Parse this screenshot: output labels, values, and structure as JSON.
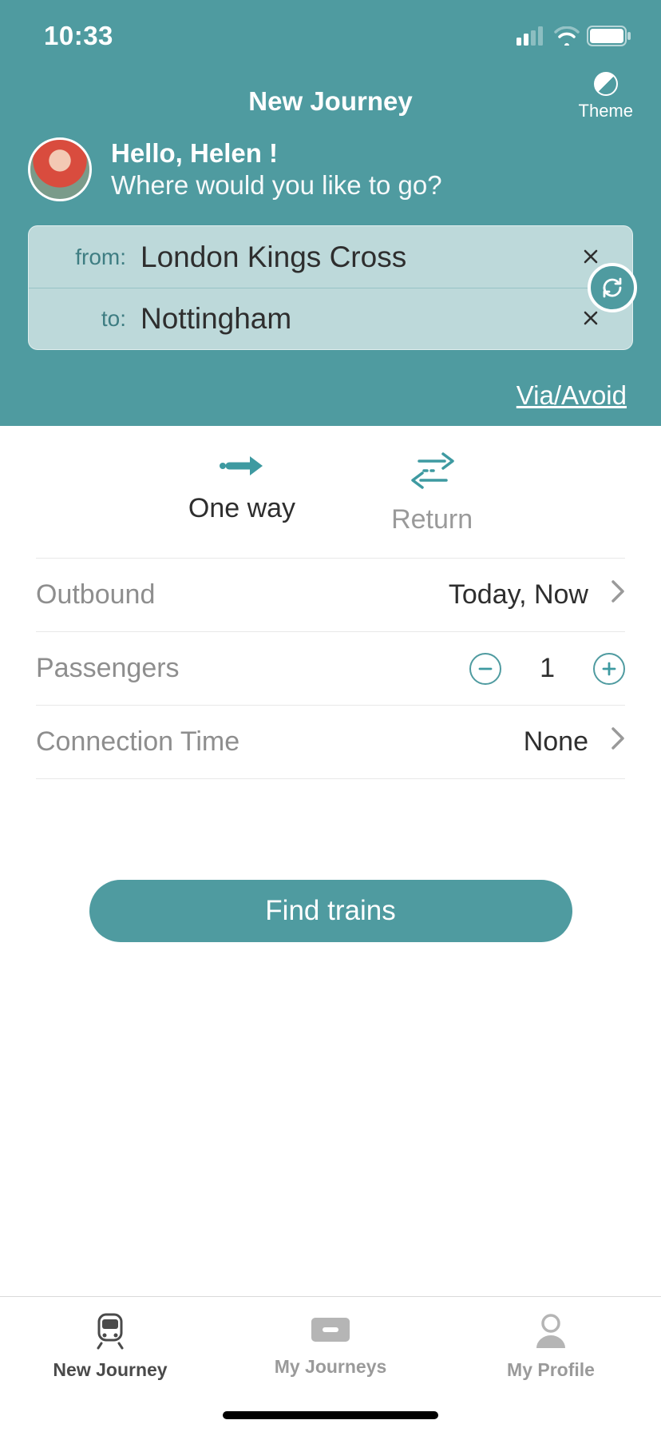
{
  "status": {
    "time": "10:33"
  },
  "header": {
    "title": "New Journey",
    "theme_label": "Theme",
    "greeting_hello": "Hello, Helen !",
    "greeting_sub": "Where would you like to go?",
    "from_label": "from:",
    "to_label": "to:",
    "from_value": "London Kings Cross",
    "to_value": "Nottingham",
    "via_avoid": "Via/Avoid"
  },
  "trip_type": {
    "one_way": "One way",
    "return": "Return"
  },
  "form": {
    "outbound_label": "Outbound",
    "outbound_value": "Today, Now",
    "passengers_label": "Passengers",
    "passengers_value": "1",
    "connection_label": "Connection Time",
    "connection_value": "None"
  },
  "actions": {
    "find_trains": "Find trains"
  },
  "tabs": {
    "new_journey": "New Journey",
    "my_journeys": "My Journeys",
    "my_profile": "My Profile"
  },
  "colors": {
    "teal": "#4f9ba0"
  }
}
